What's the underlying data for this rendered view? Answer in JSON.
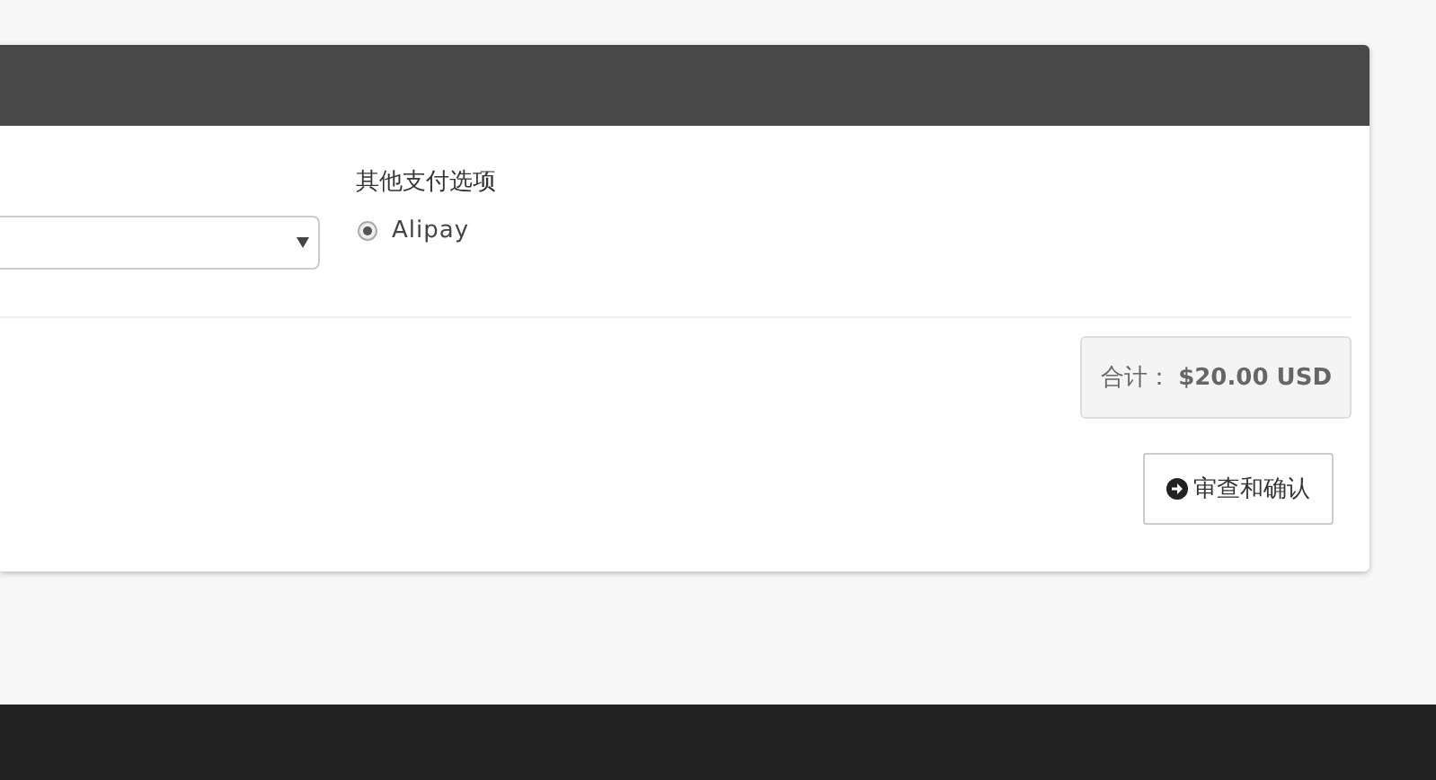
{
  "payment_options": {
    "label": "其他支付选项",
    "options": [
      {
        "label": "Alipay",
        "selected": true
      }
    ]
  },
  "total": "合计： **$20.00 USD**",
  "confirm_button": "审查和确认"
}
